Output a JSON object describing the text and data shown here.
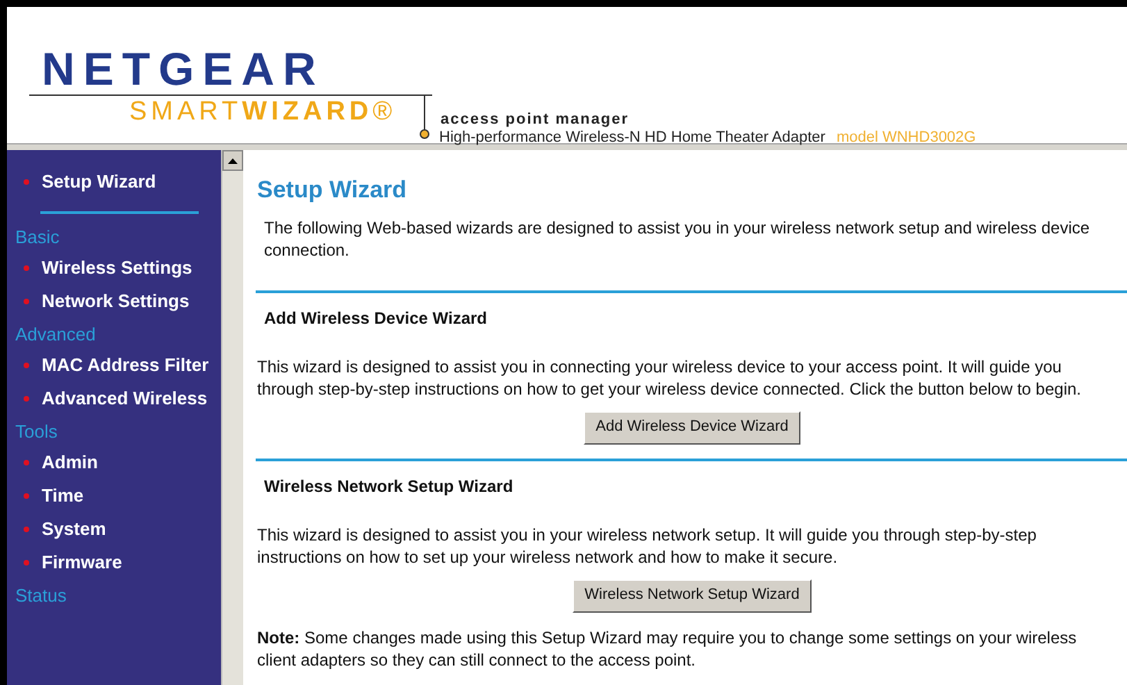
{
  "header": {
    "brand": "NETGEAR",
    "product": "SMART**WIZARD**®",
    "subtitle": "access point manager",
    "description": "High-performance Wireless-N HD Home Theater Adapter",
    "model": "model WNHD3002G"
  },
  "sidebar": {
    "items": [
      {
        "kind": "link",
        "label": "Setup Wizard"
      },
      {
        "kind": "divider"
      },
      {
        "kind": "heading",
        "label": "Basic"
      },
      {
        "kind": "link",
        "label": "Wireless Settings"
      },
      {
        "kind": "link",
        "label": "Network Settings"
      },
      {
        "kind": "heading",
        "label": "Advanced"
      },
      {
        "kind": "link",
        "label": "MAC Address Filter"
      },
      {
        "kind": "link",
        "label": "Advanced Wireless"
      },
      {
        "kind": "heading",
        "label": "Tools"
      },
      {
        "kind": "link",
        "label": "Admin"
      },
      {
        "kind": "link",
        "label": "Time"
      },
      {
        "kind": "link",
        "label": "System"
      },
      {
        "kind": "link",
        "label": "Firmware"
      },
      {
        "kind": "heading",
        "label": "Status"
      }
    ]
  },
  "content": {
    "title": "Setup Wizard",
    "intro": "The following Web-based wizards are designed to assist you in your wireless network setup and wireless device connection.",
    "sections": [
      {
        "heading": "Add Wireless Device Wizard",
        "text": "This wizard is designed to assist you in connecting your wireless device to your access point. It will guide you through step-by-step instructions on how to get your wireless device connected. Click the button below to begin.",
        "button": "Add Wireless Device Wizard"
      },
      {
        "heading": "Wireless Network Setup Wizard",
        "text": "This wizard is designed to assist you in your wireless network setup. It will guide you through step-by-step instructions on how to set up your wireless network and how to make it secure.",
        "button": "Wireless Network Setup Wizard"
      }
    ],
    "note": "**Note:** Some changes made using this Setup Wizard may require you to change some settings on your wireless client adapters so they can still connect to the access point."
  }
}
